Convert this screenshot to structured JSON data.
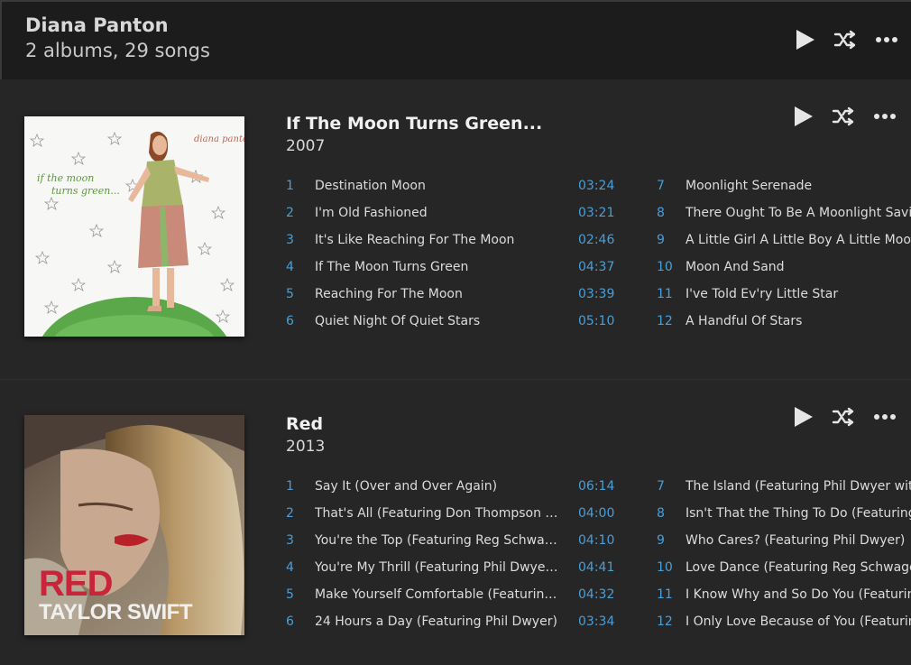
{
  "artist": {
    "name": "Diana Panton",
    "summary": "2 albums, 29 songs"
  },
  "albums": [
    {
      "title": "If The Moon Turns Green...",
      "year": "2007",
      "cover_text": [
        "diana panton",
        "if the moon",
        "turns green..."
      ],
      "tracks_left": [
        {
          "num": "1",
          "title": "Destination Moon",
          "duration": "03:24"
        },
        {
          "num": "2",
          "title": "I'm Old Fashioned",
          "duration": "03:21"
        },
        {
          "num": "3",
          "title": "It's Like Reaching For The Moon",
          "duration": "02:46"
        },
        {
          "num": "4",
          "title": "If The Moon Turns Green",
          "duration": "04:37"
        },
        {
          "num": "5",
          "title": "Reaching For The Moon",
          "duration": "03:39"
        },
        {
          "num": "6",
          "title": "Quiet Night Of Quiet Stars",
          "duration": "05:10"
        }
      ],
      "tracks_right": [
        {
          "num": "7",
          "title": "Moonlight Serenade"
        },
        {
          "num": "8",
          "title": "There Ought To Be A Moonlight Saving Time"
        },
        {
          "num": "9",
          "title": "A Little Girl A Little Boy A Little Moon"
        },
        {
          "num": "10",
          "title": "Moon And Sand"
        },
        {
          "num": "11",
          "title": "I've Told Ev'ry Little Star"
        },
        {
          "num": "12",
          "title": "A Handful Of Stars"
        }
      ]
    },
    {
      "title": "Red",
      "year": "2013",
      "cover_text": [
        "RED",
        "TAYLOR SWIFT"
      ],
      "tracks_left": [
        {
          "num": "1",
          "title": "Say It (Over and Over Again)",
          "duration": "06:14"
        },
        {
          "num": "2",
          "title": "That's All (Featuring Don Thompson with Phil Dwyer)",
          "duration": "04:00"
        },
        {
          "num": "3",
          "title": "You're the Top (Featuring Reg Schwager)",
          "duration": "04:10"
        },
        {
          "num": "4",
          "title": "You're My Thrill (Featuring Phil Dwyer with Reg Schwager)",
          "duration": "04:41"
        },
        {
          "num": "5",
          "title": "Make Yourself Comfortable (Featuring Reg Schwager)",
          "duration": "04:32"
        },
        {
          "num": "6",
          "title": "24 Hours a Day (Featuring Phil Dwyer)",
          "duration": "03:34"
        }
      ],
      "tracks_right": [
        {
          "num": "7",
          "title": "The Island (Featuring Phil Dwyer with Reg Schwager)"
        },
        {
          "num": "8",
          "title": "Isn't That the Thing To Do (Featuring Reg Schwager)"
        },
        {
          "num": "9",
          "title": "Who Cares? (Featuring Phil Dwyer)"
        },
        {
          "num": "10",
          "title": "Love Dance (Featuring Reg Schwager)"
        },
        {
          "num": "11",
          "title": "I Know Why and So Do You (Featuring Phil Dwyer)"
        },
        {
          "num": "12",
          "title": "I Only Love Because of You (Featuring Reg Schwager)"
        }
      ]
    }
  ],
  "icons": {
    "play": "play-icon",
    "shuffle": "shuffle-icon",
    "more": "more-icon"
  },
  "colors": {
    "accent": "#4a9fd8",
    "background": "#262626",
    "header": "#1c1c1c"
  }
}
